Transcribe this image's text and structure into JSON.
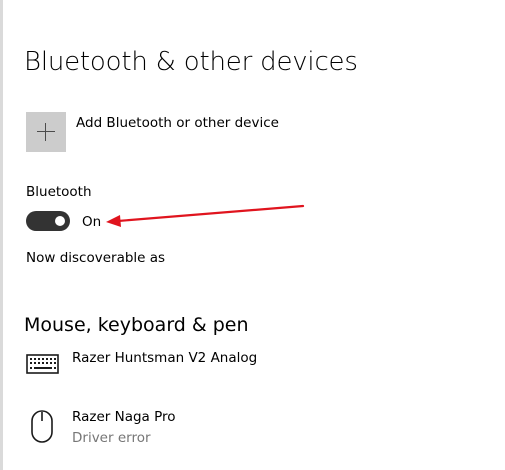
{
  "page": {
    "title": "Bluetooth & other devices"
  },
  "add_device": {
    "label": "Add Bluetooth or other device",
    "icon": "plus-icon"
  },
  "bluetooth": {
    "heading": "Bluetooth",
    "toggle_on": true,
    "toggle_label": "On",
    "discoverable_text": "Now discoverable as"
  },
  "annotation": {
    "arrow_color": "#e0141e"
  },
  "mouse_keyboard_pen": {
    "title": "Mouse, keyboard & pen",
    "devices": [
      {
        "name": "Razer Huntsman V2 Analog",
        "status": "",
        "icon": "keyboard-icon"
      },
      {
        "name": "Razer Naga Pro",
        "status": "Driver error",
        "icon": "mouse-icon"
      }
    ]
  },
  "colors": {
    "toggle_on_track": "#333333",
    "secondary_text": "#767676",
    "add_tile": "#cccccc"
  }
}
